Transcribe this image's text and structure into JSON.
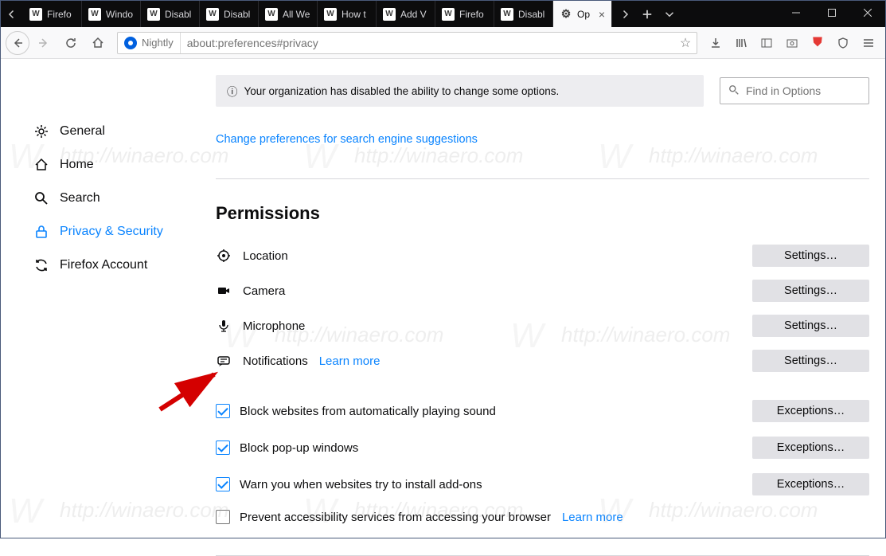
{
  "tabs": [
    {
      "label": "Firefo"
    },
    {
      "label": "Windo"
    },
    {
      "label": "Disabl"
    },
    {
      "label": "Disabl"
    },
    {
      "label": "All We"
    },
    {
      "label": "How t"
    },
    {
      "label": "Add V"
    },
    {
      "label": "Firefo"
    },
    {
      "label": "Disabl"
    },
    {
      "label": "Op",
      "active": true
    }
  ],
  "url": {
    "identity": "Nightly",
    "address": "about:preferences#privacy"
  },
  "search_placeholder": "Find in Options",
  "info_text": "Your organization has disabled the ability to change some options.",
  "link_suggestions": "Change preferences for search engine suggestions",
  "sidebar": {
    "general": "General",
    "home": "Home",
    "search": "Search",
    "privacy": "Privacy & Security",
    "account": "Firefox Account"
  },
  "permissions": {
    "heading": "Permissions",
    "location": "Location",
    "camera": "Camera",
    "microphone": "Microphone",
    "notifications": "Notifications",
    "learn_more": "Learn more",
    "settings_btn": "Settings…",
    "exceptions_btn": "Exceptions…",
    "block_sound": "Block websites from automatically playing sound",
    "block_popups": "Block pop-up windows",
    "warn_addons": "Warn you when websites try to install add-ons",
    "prevent_a11y": "Prevent accessibility services from accessing your browser"
  },
  "watermark_text": "http://winaero.com"
}
